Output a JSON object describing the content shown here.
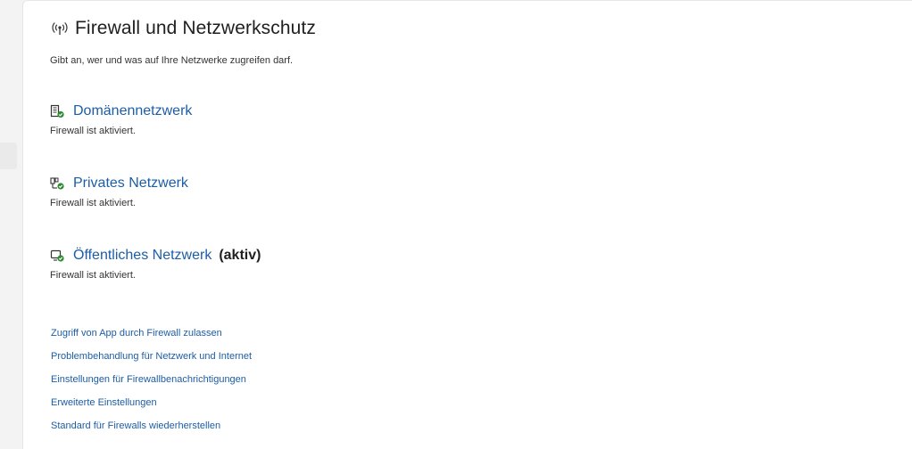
{
  "header": {
    "title": "Firewall und Netzwerkschutz",
    "subtitle": "Gibt an, wer und was auf Ihre Netzwerke zugreifen darf."
  },
  "networks": [
    {
      "name": "Domänennetzwerk",
      "status": "Firewall ist aktiviert.",
      "active_label": "",
      "icon": "domain-network-icon"
    },
    {
      "name": "Privates Netzwerk",
      "status": "Firewall ist aktiviert.",
      "active_label": "",
      "icon": "private-network-icon"
    },
    {
      "name": "Öffentliches Netzwerk",
      "status": "Firewall ist aktiviert.",
      "active_label": "(aktiv)",
      "icon": "public-network-icon"
    }
  ],
  "links": [
    "Zugriff von App durch Firewall zulassen",
    "Problembehandlung für Netzwerk und Internet",
    "Einstellungen für Firewallbenachrichtigungen",
    "Erweiterte Einstellungen",
    "Standard für Firewalls wiederherstellen"
  ],
  "colors": {
    "link": "#1b5da8",
    "status_green": "#2e8b34",
    "text": "#1f1f1f"
  }
}
